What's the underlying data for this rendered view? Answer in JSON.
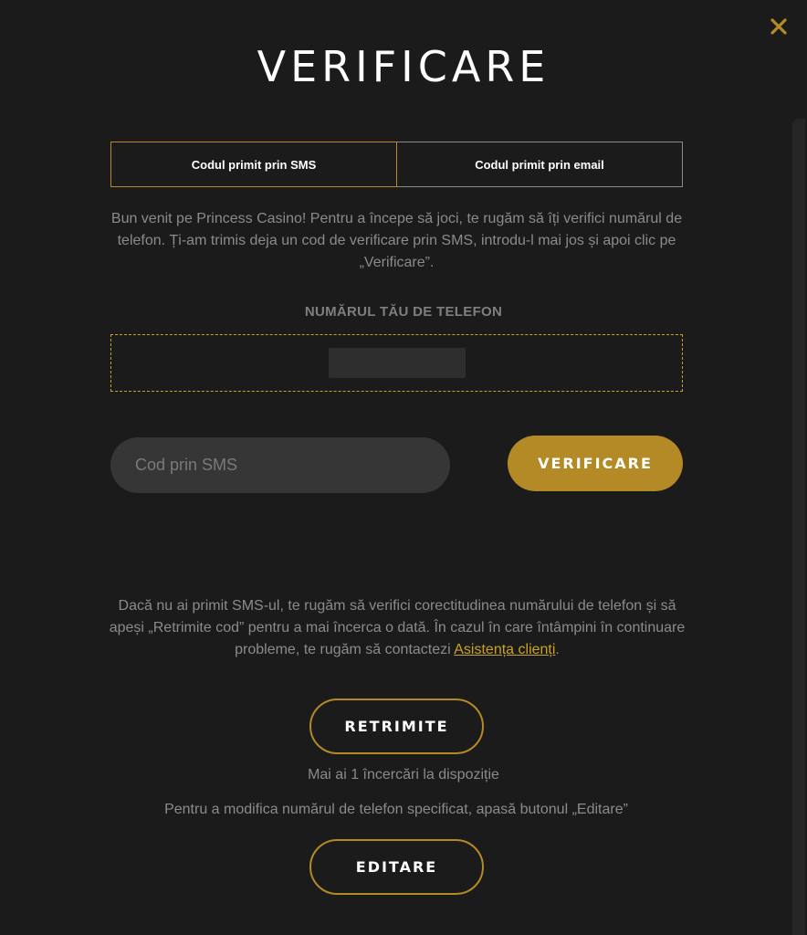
{
  "modal": {
    "title": "VERIFICARE"
  },
  "tabs": [
    {
      "label": "Codul primit prin SMS",
      "active": true
    },
    {
      "label": "Codul primit prin email",
      "active": false
    }
  ],
  "intro_text": "Bun venit pe Princess Casino! Pentru a începe să joci, te rugăm să îți verifici numărul de telefon. Ți-am trimis deja un cod de verificare prin SMS, introdu-l mai jos și apoi clic pe „Verificare”.",
  "phone": {
    "label": "NUMĂRUL TĂU DE TELEFON"
  },
  "sms_code": {
    "placeholder": "Cod prin SMS",
    "value": ""
  },
  "verify_button": {
    "label": "VERIFICARE"
  },
  "help": {
    "text_before_link": "Dacă nu ai primit SMS-ul, te rugăm să verifici corectitudinea numărului de telefon și să apeși „Retrimite cod” pentru a mai încerca o dată. În cazul în care întâmpini în continuare probleme, te rugăm să contactezi ",
    "link_label": "Asistența clienți",
    "text_after_link": "."
  },
  "resend_button": {
    "label": "RETRIMITE"
  },
  "attempts_text": "Mai ai 1 încercări la dispoziție",
  "edit_hint": "Pentru a modifica numărul de telefon specificat, apasă butonul „Editare”",
  "edit_button": {
    "label": "EDITARE"
  },
  "colors": {
    "background": "#1b1b1b",
    "accent": "#b48a26",
    "muted_text": "#8b8b8b"
  },
  "icons": {
    "close": "close-icon"
  }
}
